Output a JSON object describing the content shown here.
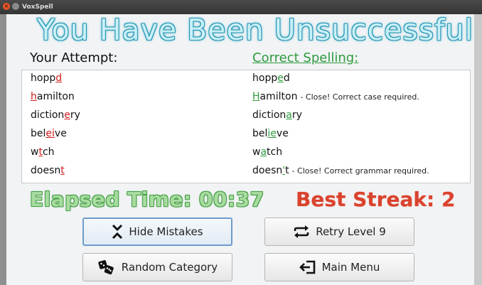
{
  "window": {
    "title": "VoxSpell"
  },
  "heading": "You Have Been Unsuccessful",
  "columns": {
    "attempt": "Your Attempt:",
    "correct": "Correct Spelling:"
  },
  "rows": [
    {
      "attempt": [
        [
          "hopp",
          ""
        ],
        [
          "d",
          "wrong"
        ]
      ],
      "correct": [
        [
          "hopp",
          ""
        ],
        [
          "e",
          "right"
        ],
        [
          "d",
          ""
        ]
      ],
      "note": ""
    },
    {
      "attempt": [
        [
          "h",
          "wrong"
        ],
        [
          "amilton",
          ""
        ]
      ],
      "correct": [
        [
          "H",
          "right"
        ],
        [
          "amilton",
          ""
        ]
      ],
      "note": "- Close! Correct case required."
    },
    {
      "attempt": [
        [
          "diction",
          ""
        ],
        [
          "e",
          "wrong"
        ],
        [
          "ry",
          ""
        ]
      ],
      "correct": [
        [
          "diction",
          ""
        ],
        [
          "a",
          "right"
        ],
        [
          "ry",
          ""
        ]
      ],
      "note": ""
    },
    {
      "attempt": [
        [
          "bel",
          ""
        ],
        [
          "ei",
          "wrong"
        ],
        [
          "ve",
          ""
        ]
      ],
      "correct": [
        [
          "bel",
          ""
        ],
        [
          "ie",
          "right"
        ],
        [
          "ve",
          ""
        ]
      ],
      "note": ""
    },
    {
      "attempt": [
        [
          "w",
          ""
        ],
        [
          "t",
          "wrong"
        ],
        [
          "ch",
          ""
        ]
      ],
      "correct": [
        [
          "w",
          ""
        ],
        [
          "a",
          "right"
        ],
        [
          "tch",
          ""
        ]
      ],
      "note": ""
    },
    {
      "attempt": [
        [
          "doesn",
          ""
        ],
        [
          "t",
          "wrong"
        ]
      ],
      "correct": [
        [
          "doesn",
          ""
        ],
        [
          "'",
          "right"
        ],
        [
          "t",
          ""
        ]
      ],
      "note": "- Close! Correct grammar required."
    }
  ],
  "elapsed_time": "Elapsed Time: 00:37",
  "best_streak": "Best Streak: 2",
  "buttons": {
    "hide_mistakes": "Hide Mistakes",
    "retry_level": "Retry Level 9",
    "random_category": "Random Category",
    "main_menu": "Main Menu"
  },
  "colors": {
    "wrong": "#d11a1a",
    "right": "#2f9a3e",
    "heading": "#c9f0f6",
    "elapsed": "#a8dba0",
    "streak": "#d9432e"
  }
}
